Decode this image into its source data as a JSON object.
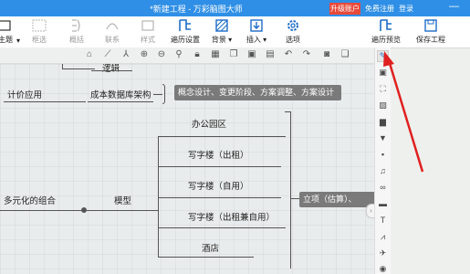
{
  "titlebar": {
    "title": "*新建工程 - 万彩脑图大师",
    "upgrade": "升级账户",
    "register": "免费注册",
    "login": "登录",
    "minimize": "—"
  },
  "ribbon": {
    "theme": "主题",
    "frame": "框选",
    "summary": "概括",
    "relation": "联系",
    "style": "样式",
    "traverse": "遍历设置",
    "background": "背景",
    "insert": "插入",
    "options": "选项",
    "preview": "遍历预览",
    "save": "保存工程"
  },
  "canvas": {
    "top_node": "逻辑",
    "pricing": "计价应用",
    "cost_db": "成本数据库架构",
    "stage_note": "概念设计、变更阶段、方案调整、方案设计",
    "park": "办公园区",
    "office_rent": "写字楼（出租）",
    "office_self": "写字楼（自用）",
    "office_mixed": "写字楼（出租兼自用）",
    "hotel": "酒店",
    "multi": "多元化的组合",
    "model": "模型",
    "project": "立项（估算）、"
  },
  "colors": {
    "titlebar": "#2f8fe6",
    "badge": "#e84a3a",
    "accent": "#1d6cc7",
    "arrow": "#e02020",
    "note_bg": "#7a7a7a"
  }
}
